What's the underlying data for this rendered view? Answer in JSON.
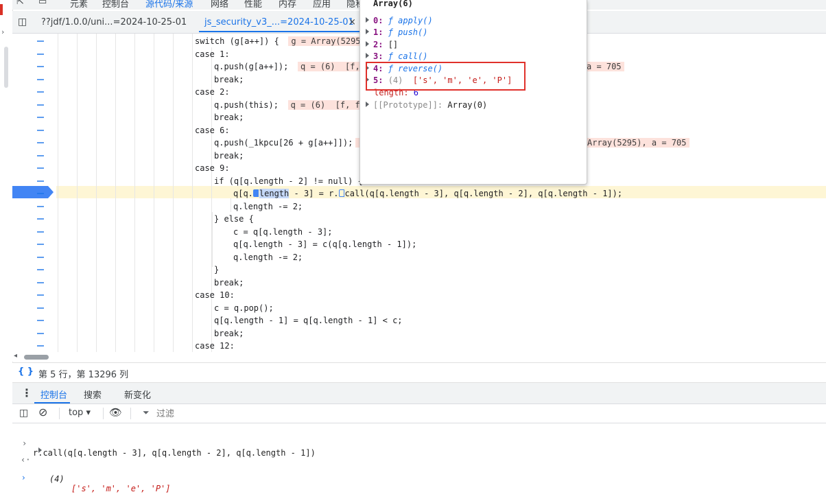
{
  "top_tabs": [
    "元素",
    "控制台",
    "源代码/来源",
    "网络",
    "性能",
    "内存",
    "应用",
    "隐私"
  ],
  "file_tabs": {
    "tab1": "??jdf/1.0.0/uni...=2024-10-25-01",
    "tab2": "js_security_v3_...=2024-10-25-01",
    "close": "×"
  },
  "code_lines": [
    {
      "indent": 0,
      "text": "switch (g[a++]) {",
      "annot": "g = Array(5295)"
    },
    {
      "indent": 0,
      "text": "case 1:"
    },
    {
      "indent": 1,
      "text": "q.push(g[a++]);",
      "annot": "q = (6)  [f,",
      "annot2": "a = 705"
    },
    {
      "indent": 1,
      "text": "break;"
    },
    {
      "indent": 0,
      "text": "case 2:"
    },
    {
      "indent": 1,
      "text": "q.push(this);",
      "annot": "q = (6)  [f, f,"
    },
    {
      "indent": 1,
      "text": "break;"
    },
    {
      "indent": 0,
      "text": "case 6:"
    },
    {
      "indent": 1,
      "text": "q.push(_1kpcu[26 + g[a++]]);",
      "annot": "",
      "annot2": "Array(5295), a = 705"
    },
    {
      "indent": 1,
      "text": "break;"
    },
    {
      "indent": 0,
      "text": "case 9:"
    },
    {
      "indent": 1,
      "text": "if (q[q.length - 2] != null) {"
    },
    {
      "indent": 2,
      "text": "q[q.length - 3] = r.call(q[q.length - 3], q[q.length - 2], q[q.length - 1]);"
    },
    {
      "indent": 2,
      "text": "q.length -= 2;"
    },
    {
      "indent": 1,
      "text": "} else {"
    },
    {
      "indent": 2,
      "text": "c = q[q.length - 3];"
    },
    {
      "indent": 2,
      "text": "q[q.length - 3] = c(q[q.length - 1]);"
    },
    {
      "indent": 2,
      "text": "q.length -= 2;"
    },
    {
      "indent": 1,
      "text": "}"
    },
    {
      "indent": 1,
      "text": "break;"
    },
    {
      "indent": 0,
      "text": "case 10:"
    },
    {
      "indent": 1,
      "text": "c = q.pop();"
    },
    {
      "indent": 1,
      "text": "q[q.length - 1] = q[q.length - 1] < c;"
    },
    {
      "indent": 1,
      "text": "break;"
    },
    {
      "indent": 0,
      "text": "case 12:"
    }
  ],
  "status": {
    "position": "第 5 行，第 13296 列"
  },
  "drawer_tabs": [
    "控制台",
    "搜索",
    "新变化"
  ],
  "console_toolbar": {
    "context": "top",
    "filter_placeholder": "过滤"
  },
  "console": {
    "input": "r.call(q[q.length - 3], q[q.length - 2], q[q.length - 1])",
    "result_count": "(4)",
    "result_items": "['s', 'm', 'e', 'P']"
  },
  "popover": {
    "title": "Array(6)",
    "rows": [
      {
        "key": "0:",
        "value": "ƒ apply()"
      },
      {
        "key": "1:",
        "value": "ƒ push()"
      },
      {
        "key": "2:",
        "value": "[]"
      },
      {
        "key": "3:",
        "value": "ƒ call()"
      },
      {
        "key": "4:",
        "value": "ƒ reverse()"
      },
      {
        "key": "5:",
        "count": "(4)",
        "value": "['s', 'm', 'e', 'P']"
      },
      {
        "key": "length:",
        "value": "6"
      },
      {
        "key": "[[Prototype]]:",
        "value": "Array(0)"
      }
    ]
  },
  "colors": {
    "accent": "#1a73e8",
    "highlight_box": "#e0302a",
    "current_line": "#fef6d5"
  }
}
